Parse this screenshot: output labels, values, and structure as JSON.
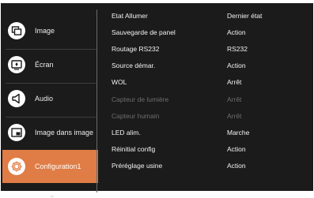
{
  "sidebar": {
    "items": [
      {
        "label": "Image",
        "icon": "picture-mode-icon",
        "active": false
      },
      {
        "label": "Écran",
        "icon": "screen-icon",
        "active": false
      },
      {
        "label": "Audio",
        "icon": "speaker-icon",
        "active": false
      },
      {
        "label": "Image dans image",
        "icon": "picture-in-picture-icon",
        "active": false
      },
      {
        "label": "Configuration1",
        "icon": "gear-icon",
        "active": true
      }
    ]
  },
  "settings": {
    "rows": [
      {
        "name": "Etat Allumer",
        "value": "Dernier état",
        "enabled": true
      },
      {
        "name": "Sauvegarde de panel",
        "value": "Action",
        "enabled": true
      },
      {
        "name": "Routage RS232",
        "value": "RS232",
        "enabled": true
      },
      {
        "name": "Source démar.",
        "value": "Action",
        "enabled": true
      },
      {
        "name": "WOL",
        "value": "Arrêt",
        "enabled": true
      },
      {
        "name": "Capteur de lumière",
        "value": "Arrêt",
        "enabled": false
      },
      {
        "name": "Capteur humain",
        "value": "Arrêt",
        "enabled": false
      },
      {
        "name": "LED alim.",
        "value": "Marche",
        "enabled": true
      },
      {
        "name": "Réinitial config",
        "value": "Action",
        "enabled": true
      },
      {
        "name": "Préréglage usine",
        "value": "Action",
        "enabled": true
      }
    ]
  },
  "colors": {
    "panel_bg": "#1b1b1b",
    "accent": "#e07c45",
    "text": "#f3f3f3",
    "text_disabled": "#6d6d6d"
  }
}
